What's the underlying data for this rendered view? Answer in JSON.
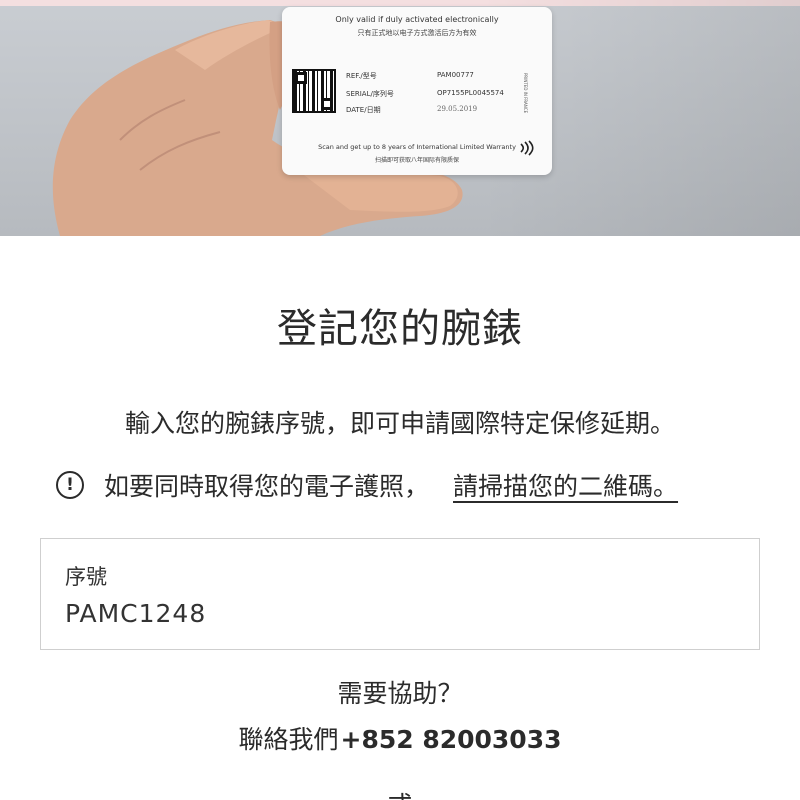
{
  "card": {
    "line1": "Only valid if duly activated electronically",
    "line2": "只有正式地以电子方式激活后方为有效",
    "ref_label": "REF./型号",
    "ref_value": "PAM00777",
    "serial_label": "SERIAL/序列号",
    "serial_value": "OP7155PL0045574",
    "date_label": "DATE/日期",
    "date_value": "29.05.2019",
    "side_text": "PRINTED IN FRANCE",
    "bottom1": "Scan and get up to 8 years of International Limited Warranty",
    "bottom2": "扫描即可获取八年国际有限质保"
  },
  "title": "登記您的腕錶",
  "description": "輸入您的腕錶序號，即可申請國際特定保修延期。",
  "notice": {
    "icon_glyph": "!",
    "text": "如要同時取得您的電子護照，",
    "link": "請掃描您的二維碼。"
  },
  "serial_field": {
    "label": "序號",
    "value": "PAMC1248"
  },
  "help": {
    "question": "需要協助？",
    "contact_prefix": "聯絡我們",
    "phone": "+852 82003033",
    "or": "或"
  }
}
